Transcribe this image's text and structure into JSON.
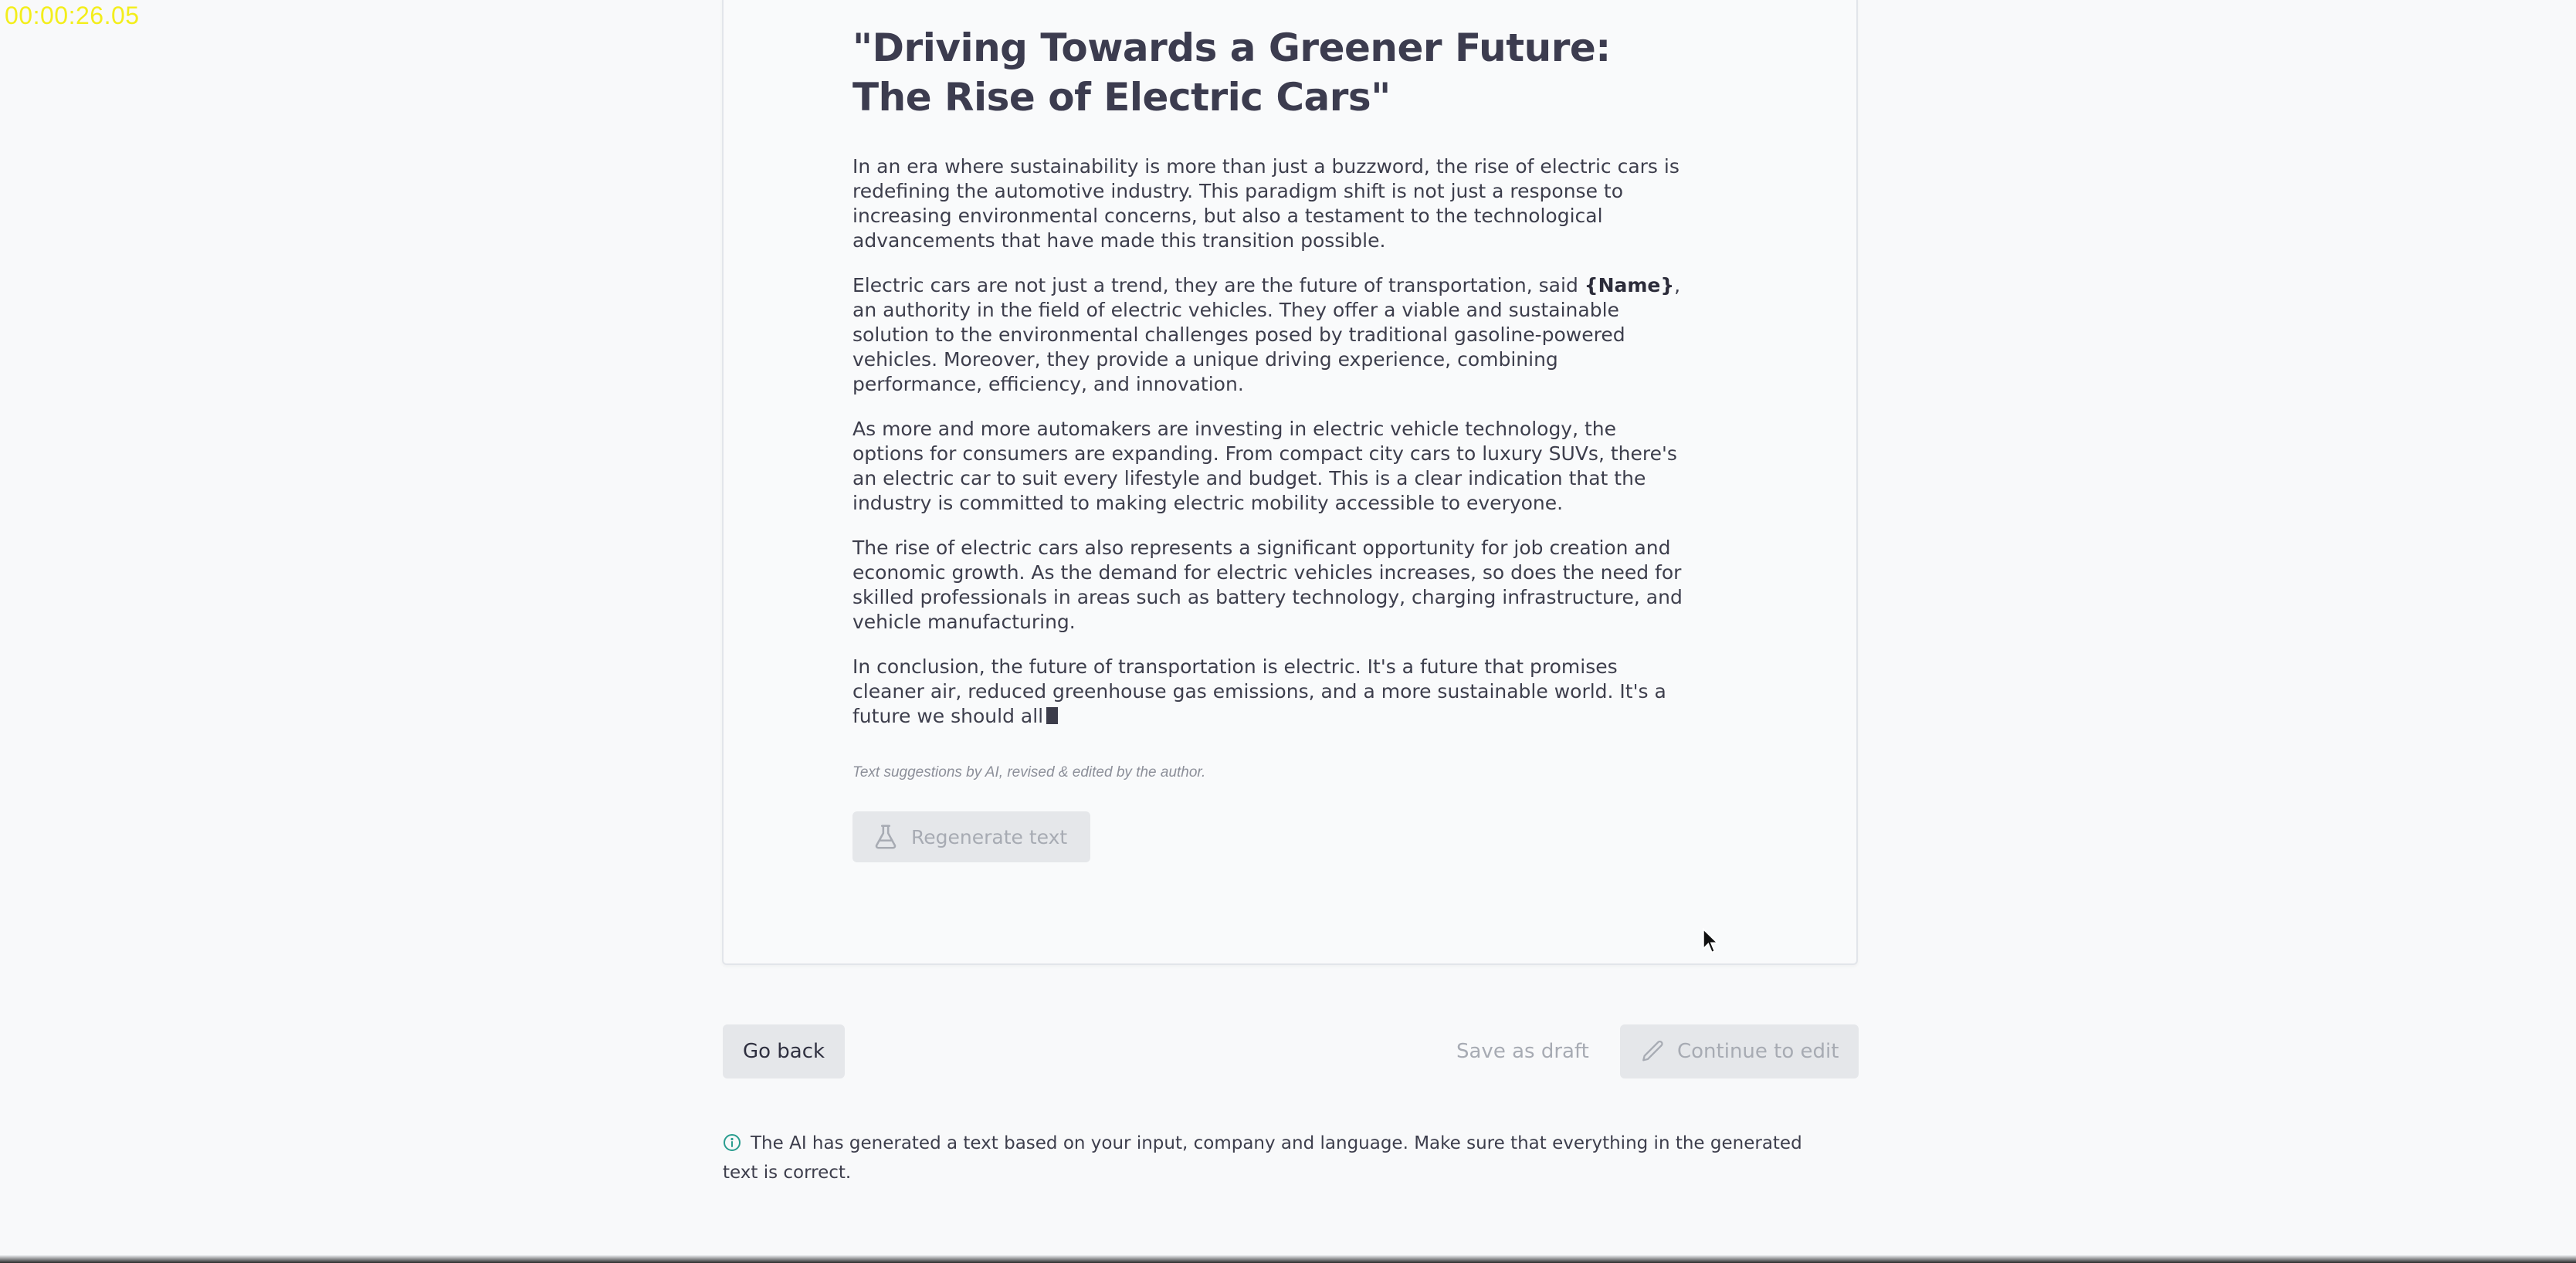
{
  "timer": "00:00:26.05",
  "article": {
    "title": "\"Driving Towards a Greener Future: The Rise of Electric Cars\"",
    "paragraphs": {
      "p1": "In an era where sustainability is more than just a buzzword, the rise of electric cars is redefining the automotive industry. This paradigm shift is not just a response to increasing environmental concerns, but also a testament to the technological advancements that have made this transition possible.",
      "p2_before": "Electric cars are not just a trend, they are the future of transportation, said ",
      "p2_name": "{Name}",
      "p2_after": ", an authority in the field of electric vehicles. They offer a viable and sustainable solution to the environmental challenges posed by traditional gasoline-powered vehicles. Moreover, they provide a unique driving experience, combining performance, efficiency, and innovation.",
      "p3": "As more and more automakers are investing in electric vehicle technology, the options for consumers are expanding. From compact city cars to luxury SUVs, there's an electric car to suit every lifestyle and budget. This is a clear indication that the industry is committed to making electric mobility accessible to everyone.",
      "p4": "The rise of electric cars also represents a significant opportunity for job creation and economic growth. As the demand for electric vehicles increases, so does the need for skilled professionals in areas such as battery technology, charging infrastructure, and vehicle manufacturing.",
      "p5": "In conclusion, the future of transportation is electric. It's a future that promises cleaner air, reduced greenhouse gas emissions, and a more sustainable world. It's a future we should all"
    },
    "disclaimer": "Text suggestions by AI, revised & edited by the author."
  },
  "buttons": {
    "regenerate": "Regenerate text",
    "go_back": "Go back",
    "save_draft": "Save as draft",
    "continue_edit": "Continue to edit"
  },
  "info": {
    "icon": "info-circle-icon",
    "text": "The AI has generated a text based on your input, company and language. Make sure that everything in the generated text is correct."
  },
  "colors": {
    "timer": "#f3ee1b",
    "info_icon": "#2a9d8f",
    "disabled_text": "#a7abb3",
    "button_bg": "#e5e7ea"
  }
}
